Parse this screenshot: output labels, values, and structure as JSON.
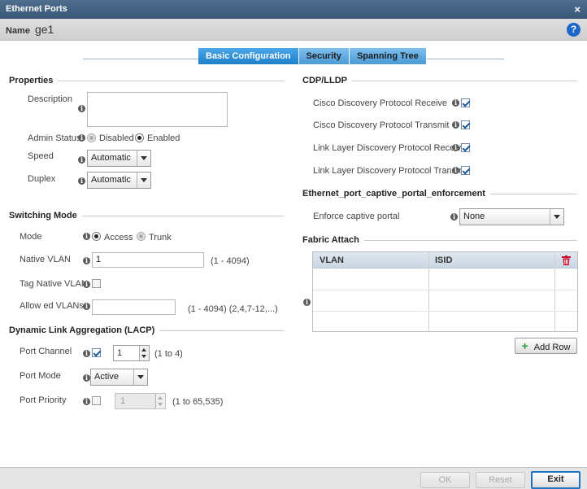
{
  "window": {
    "title": "Ethernet Ports"
  },
  "name_bar": {
    "label": "Name",
    "value": "ge1"
  },
  "tabs": [
    {
      "label": "Basic Configuration",
      "active": true
    },
    {
      "label": "Security",
      "active": false
    },
    {
      "label": "Spanning Tree",
      "active": false
    }
  ],
  "properties": {
    "title": "Properties",
    "description_label": "Description",
    "description_value": "",
    "admin_status_label": "Admin Status",
    "admin_status_options": [
      "Disabled",
      "Enabled"
    ],
    "admin_status_selected": "Enabled",
    "speed_label": "Speed",
    "speed_value": "Automatic",
    "duplex_label": "Duplex",
    "duplex_value": "Automatic"
  },
  "switching_mode": {
    "title": "Switching Mode",
    "mode_label": "Mode",
    "mode_options": [
      "Access",
      "Trunk"
    ],
    "mode_selected": "Access",
    "native_vlan_label": "Native VLAN",
    "native_vlan_value": "1",
    "native_vlan_range": "(1 - 4094)",
    "tag_native_vlan_label": "Tag Native VLAN",
    "tag_native_vlan_checked": false,
    "allowed_vlans_label": "Allow ed VLANs",
    "allowed_vlans_value": "",
    "allowed_vlans_hint": "(1 - 4094)  (2,4,7-12,...)"
  },
  "lacp": {
    "title": "Dynamic Link Aggregation (LACP)",
    "port_channel_label": "Port Channel",
    "port_channel_checked": true,
    "port_channel_value": "1",
    "port_channel_range": "(1 to 4)",
    "port_mode_label": "Port Mode",
    "port_mode_value": "Active",
    "port_priority_label": "Port Priority",
    "port_priority_checked": false,
    "port_priority_value": "1",
    "port_priority_range": "(1 to 65,535)"
  },
  "cdp_lldp": {
    "title": "CDP/LLDP",
    "items": [
      {
        "label": "Cisco Discovery Protocol Receive",
        "checked": true
      },
      {
        "label": "Cisco Discovery Protocol Transmit",
        "checked": true
      },
      {
        "label": "Link Layer Discovery Protocol Receive",
        "checked": true
      },
      {
        "label": "Link Layer Discovery Protocol Transmit",
        "checked": true
      }
    ]
  },
  "captive_portal": {
    "title": "Ethernet_port_captive_portal_enforcement",
    "enforce_label": "Enforce captive portal",
    "enforce_value": "None"
  },
  "fabric_attach": {
    "title": "Fabric Attach",
    "columns": [
      "VLAN",
      "ISID"
    ],
    "rows": [],
    "add_row_label": "Add Row"
  },
  "footer": {
    "ok_label": "OK",
    "reset_label": "Reset",
    "exit_label": "Exit"
  },
  "colors": {
    "title_bar": "#3b5878",
    "tab_active": "#1f7fc8",
    "tab_inactive": "#4a9bd6",
    "check": "#1d5a9e",
    "help": "#1a66c9",
    "trash": "#c8102e",
    "add": "#2e9e3a"
  },
  "icons": {
    "close": "close-icon",
    "help": "help-icon",
    "info": "info-icon",
    "delete": "trash-icon",
    "add": "plus-icon"
  }
}
